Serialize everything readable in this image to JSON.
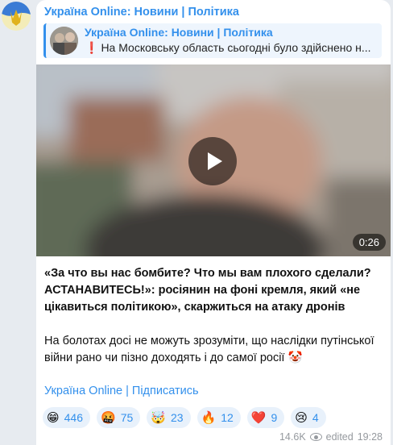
{
  "channel": {
    "name": "Україна Online: Новини | Політика"
  },
  "reply": {
    "title": "Україна Online: Новини | Політика",
    "icon": "exclamation-icon",
    "excerpt": "На Московську область сьогодні було здійснено н..."
  },
  "video": {
    "duration": "0:26",
    "play_icon": "play-icon"
  },
  "post": {
    "headline": "«За что вы нас бомбите? Что мы вам плохого сделали? АСТАНАВИТЕСЬ!»: росіянин на фоні кремля, який «не цікавиться політикою», скаржиться на атаку дронів",
    "body": "На болотах досі не можуть зрозуміти, що наслідки путінської війни рано чи пізно доходять і до самої росії 🤡"
  },
  "subscribe_link": "Україна Online | Підписатись",
  "reactions": [
    {
      "emoji": "😁",
      "count": "446"
    },
    {
      "emoji": "🤬",
      "count": "75"
    },
    {
      "emoji": "🤯",
      "count": "23"
    },
    {
      "emoji": "🔥",
      "count": "12"
    },
    {
      "emoji": "❤️",
      "count": "9"
    },
    {
      "emoji": "😢",
      "count": "4"
    }
  ],
  "meta": {
    "views": "14.6K",
    "views_icon": "eye-icon",
    "edited": "edited",
    "time": "19:28"
  },
  "colors": {
    "accent": "#3390ec",
    "background": "#e7ebf0",
    "reaction_bg": "#e8f1fb"
  }
}
